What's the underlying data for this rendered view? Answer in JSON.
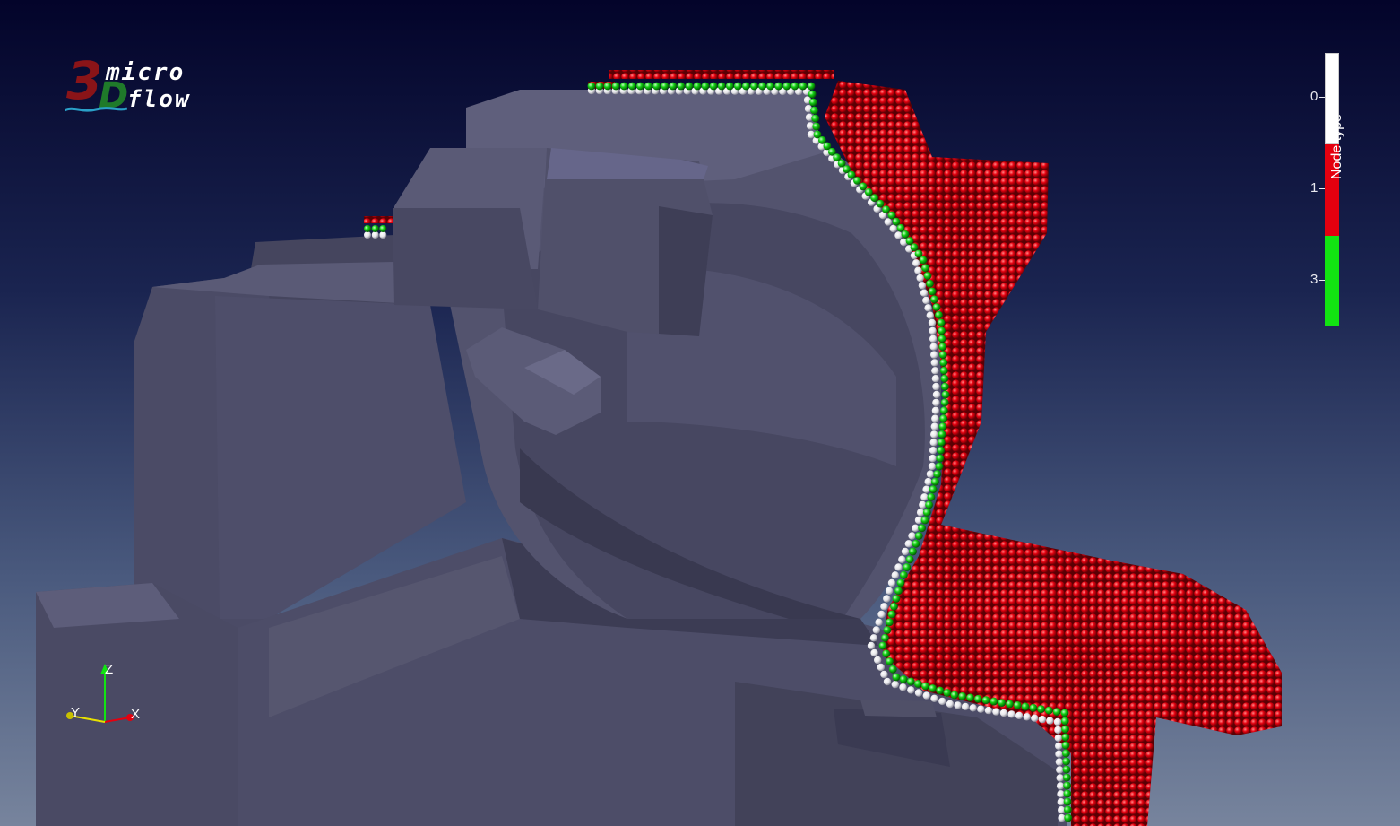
{
  "logo": {
    "digit": "3",
    "letter": "D",
    "word1": "micro",
    "word2": "flow"
  },
  "legend": {
    "title": "Node type",
    "entries": [
      {
        "label": "0",
        "color": "#ffffff"
      },
      {
        "label": "1",
        "color": "#e4000f"
      },
      {
        "label": "3",
        "color": "#12e412"
      }
    ]
  },
  "axes": {
    "z_label": "Z",
    "y_label": "Y",
    "x_label": "X",
    "z_color": "#12e412",
    "x_color": "#e4000f",
    "y_color": "#e8e000"
  },
  "colors": {
    "model": "#4a4a64",
    "model_light": "#5c5c78",
    "model_dark": "#383850",
    "node_wall": "#ffffff",
    "node_fluid": "#e4000f",
    "node_boundary": "#12e412"
  }
}
